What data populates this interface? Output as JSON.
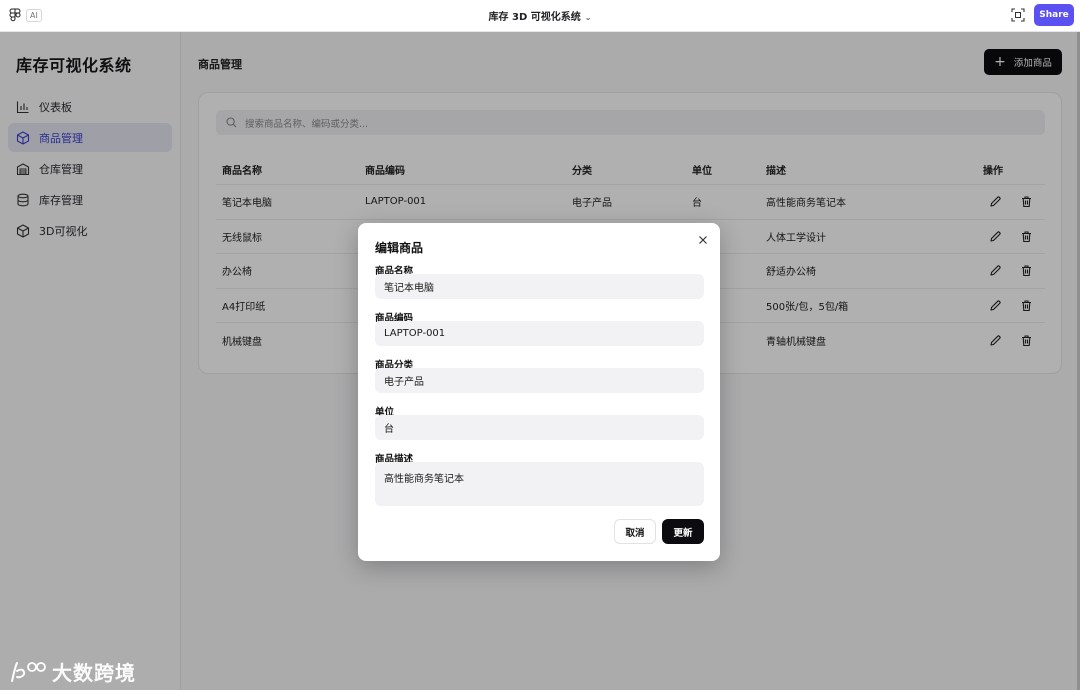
{
  "topbar": {
    "ai_badge": "AI",
    "doc_title": "库存 3D 可视化系统",
    "share_label": "Share",
    "share_color": "#5b50f0"
  },
  "sidebar": {
    "title": "库存可视化系统",
    "items": [
      {
        "label": "仪表板",
        "icon": "bar-chart-icon",
        "active": false
      },
      {
        "label": "商品管理",
        "icon": "cube-icon",
        "active": true
      },
      {
        "label": "仓库管理",
        "icon": "warehouse-icon",
        "active": false
      },
      {
        "label": "库存管理",
        "icon": "database-icon",
        "active": false
      },
      {
        "label": "3D可视化",
        "icon": "cube-3d-icon",
        "active": false
      }
    ],
    "active_color": "#3a3fcc"
  },
  "main": {
    "page_title": "商品管理",
    "add_button": "添加商品",
    "search_placeholder": "搜索商品名称、编码或分类...",
    "table": {
      "headers": [
        "商品名称",
        "商品编码",
        "分类",
        "单位",
        "描述",
        "操作"
      ],
      "rows": [
        {
          "name": "笔记本电脑",
          "code": "LAPTOP-001",
          "category": "电子产品",
          "unit": "台",
          "desc": "高性能商务笔记本"
        },
        {
          "name": "无线鼠标",
          "code": "",
          "category": "",
          "unit": "",
          "desc": "人体工学设计"
        },
        {
          "name": "办公椅",
          "code": "",
          "category": "",
          "unit": "",
          "desc": "舒适办公椅"
        },
        {
          "name": "A4打印纸",
          "code": "",
          "category": "",
          "unit": "",
          "desc": "500张/包，5包/箱"
        },
        {
          "name": "机械键盘",
          "code": "",
          "category": "",
          "unit": "",
          "desc": "青轴机械键盘"
        }
      ]
    }
  },
  "modal": {
    "title": "编辑商品",
    "fields": {
      "name_label": "商品名称",
      "name_value": "笔记本电脑",
      "code_label": "商品编码",
      "code_value": "LAPTOP-001",
      "category_label": "商品分类",
      "category_value": "电子产品",
      "unit_label": "单位",
      "unit_value": "台",
      "desc_label": "商品描述",
      "desc_value": "高性能商务笔记本"
    },
    "cancel_label": "取消",
    "update_label": "更新"
  },
  "watermark": {
    "text": "大数跨境"
  }
}
